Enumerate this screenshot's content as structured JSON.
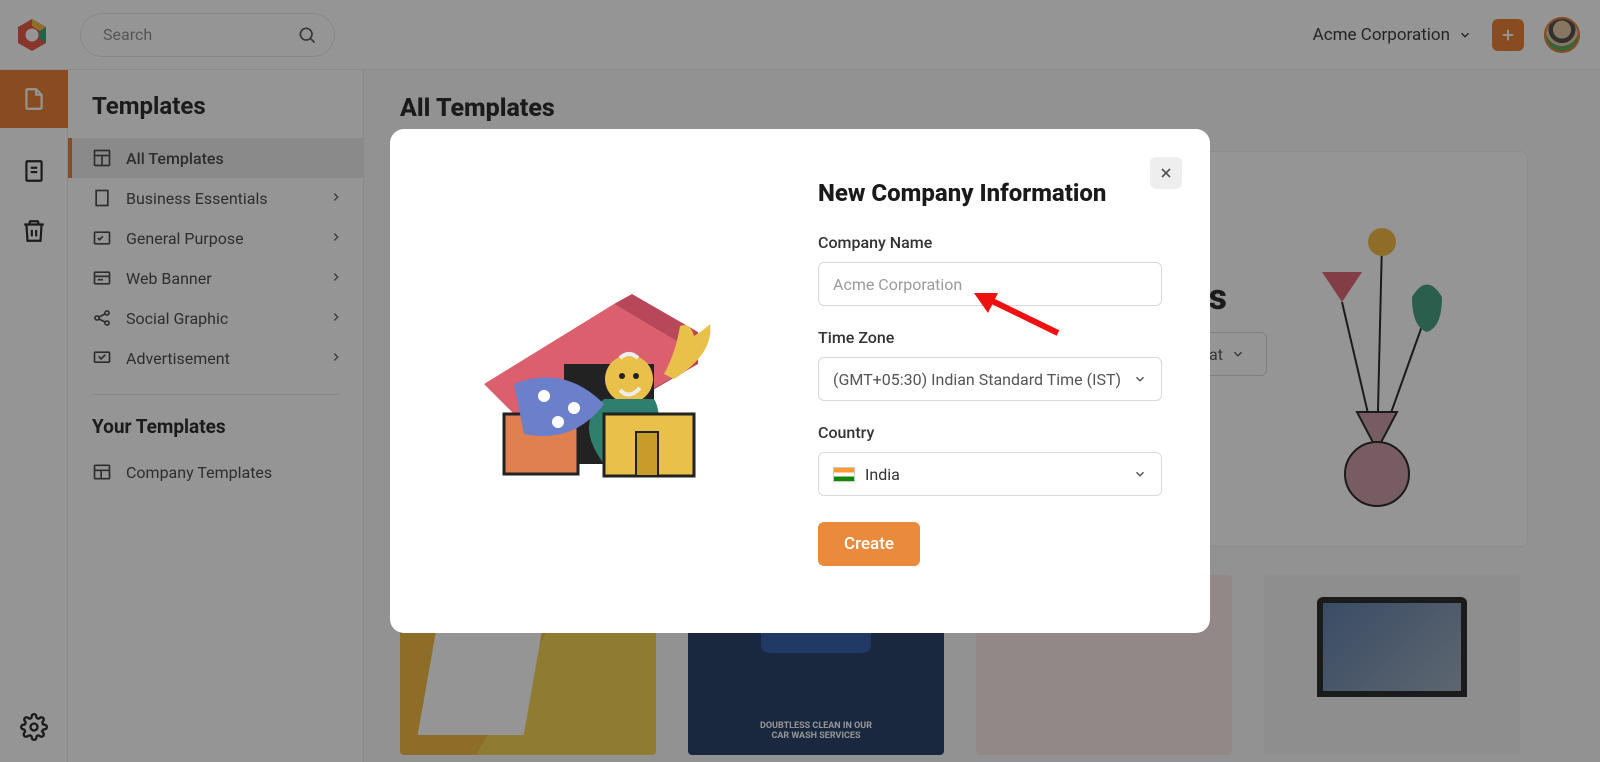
{
  "topbar": {
    "search_placeholder": "Search",
    "workspace_name": "Acme Corporation"
  },
  "sidebar": {
    "title": "Templates",
    "items": [
      {
        "label": "All Templates"
      },
      {
        "label": "Business Essentials"
      },
      {
        "label": "General Purpose"
      },
      {
        "label": "Web Banner"
      },
      {
        "label": "Social Graphic"
      },
      {
        "label": "Advertisement"
      }
    ],
    "section2_title": "Your Templates",
    "company_templates_label": "Company Templates"
  },
  "main": {
    "title": "All Templates",
    "hero_suffix": "s",
    "size_button": "mat"
  },
  "modal": {
    "title": "New Company Information",
    "company_name_label": "Company Name",
    "company_name_value": "Acme Corporation",
    "timezone_label": "Time Zone",
    "timezone_value": "(GMT+05:30) Indian Standard Time (IST)",
    "country_label": "Country",
    "country_value": "India",
    "create_label": "Create"
  }
}
